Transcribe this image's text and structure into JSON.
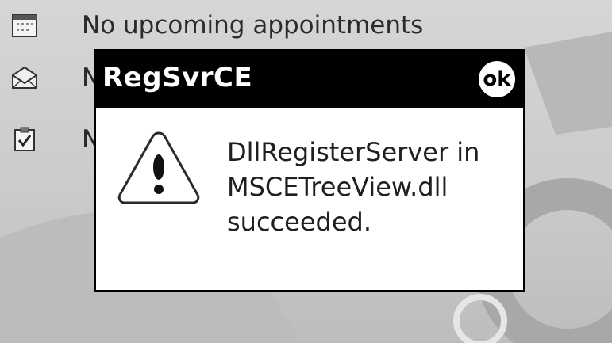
{
  "today": {
    "items": [
      {
        "icon": "calendar-icon",
        "label": "No upcoming appointments"
      },
      {
        "icon": "envelope-icon",
        "label": "N"
      },
      {
        "icon": "tasks-clipboard-icon",
        "label": "N"
      }
    ]
  },
  "dialog": {
    "title": "RegSvrCE",
    "ok_label": "ok",
    "icon": "warning-icon",
    "message_lines": [
      "DllRegisterServer in",
      "MSCETreeView.dll",
      "succeeded."
    ]
  },
  "colors": {
    "titlebar": "#000000",
    "dialog_body": "#ffffff",
    "background": "#c9c9c9"
  }
}
